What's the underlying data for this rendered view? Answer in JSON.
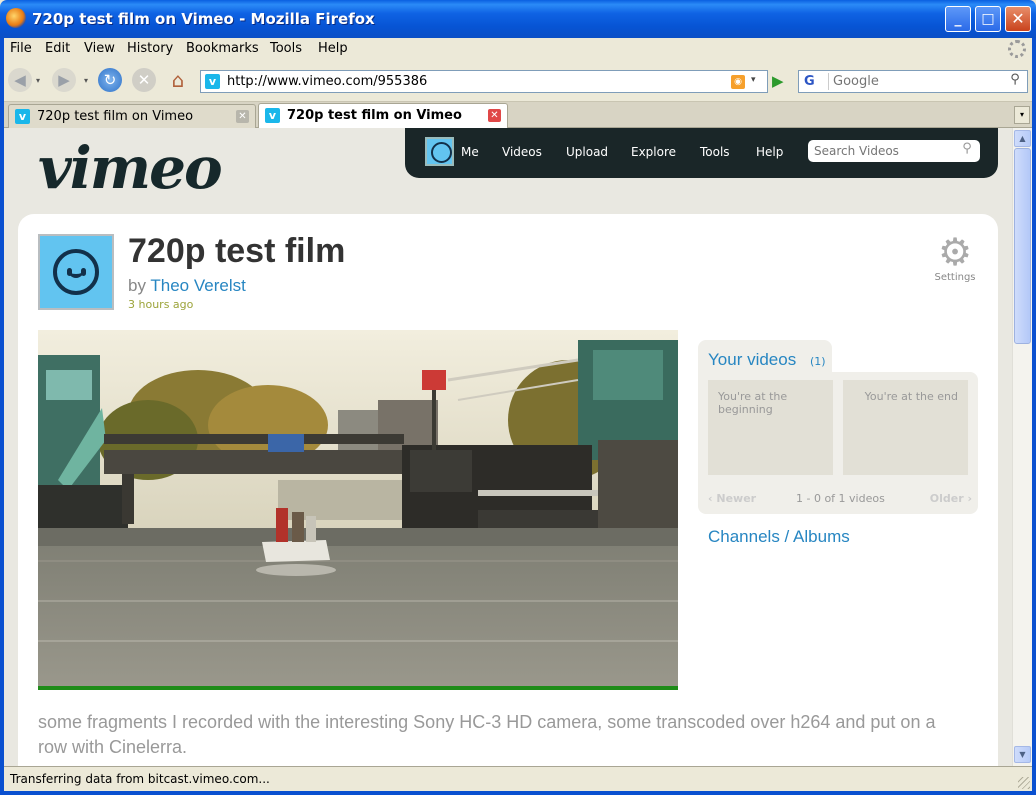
{
  "window": {
    "title": "720p test film on Vimeo - Mozilla Firefox",
    "minimize_glyph": "_",
    "maximize_glyph": "□",
    "close_glyph": "✕"
  },
  "menu": {
    "items": [
      "File",
      "Edit",
      "View",
      "History",
      "Bookmarks",
      "Tools",
      "Help"
    ]
  },
  "navigation": {
    "back_glyph": "◀",
    "forward_glyph": "▶",
    "dropdown_glyph": "▾",
    "reload_glyph": "↻",
    "stop_glyph": "✕",
    "home_glyph": "⌂",
    "url_favicon": "v",
    "url": "http://www.vimeo.com/955386",
    "rss_glyph": "◉",
    "go_glyph": "▶"
  },
  "search": {
    "engine_glyph": "G",
    "placeholder": "Google",
    "button_glyph": "⚲"
  },
  "tabs": [
    {
      "label": "720p test film on Vimeo",
      "favicon": "v",
      "close": "✕",
      "active": false
    },
    {
      "label": "720p test film on Vimeo",
      "favicon": "v",
      "close": "✕",
      "active": true
    }
  ],
  "tab_list_glyph": "▾",
  "site": {
    "logo": "vimeo",
    "nav": {
      "items": [
        "Me",
        "Videos",
        "Upload",
        "Explore",
        "Tools",
        "Help"
      ],
      "search_placeholder": "Search Videos",
      "search_glyph": "⚲"
    }
  },
  "video": {
    "title": "720p test film",
    "by_prefix": "by",
    "author": "Theo Verelst",
    "timestamp": "3 hours ago",
    "settings_glyph": "⚙",
    "settings_label": "Settings",
    "description": "some fragments I recorded with the interesting Sony HC-3 HD camera, some transcoded over h264 and put on a row with Cinelerra."
  },
  "your_videos": {
    "title": "Your videos",
    "count": "(1)",
    "slot_start": "You're at the beginning",
    "slot_end": "You're at the end",
    "newer": "‹ Newer",
    "range": "1 - 0 of 1 videos",
    "older": "Older ›"
  },
  "channels_albums": "Channels / Albums",
  "scrollbar": {
    "up_glyph": "▲",
    "down_glyph": "▼"
  },
  "status": {
    "text": "Transferring data from bitcast.vimeo.com..."
  }
}
